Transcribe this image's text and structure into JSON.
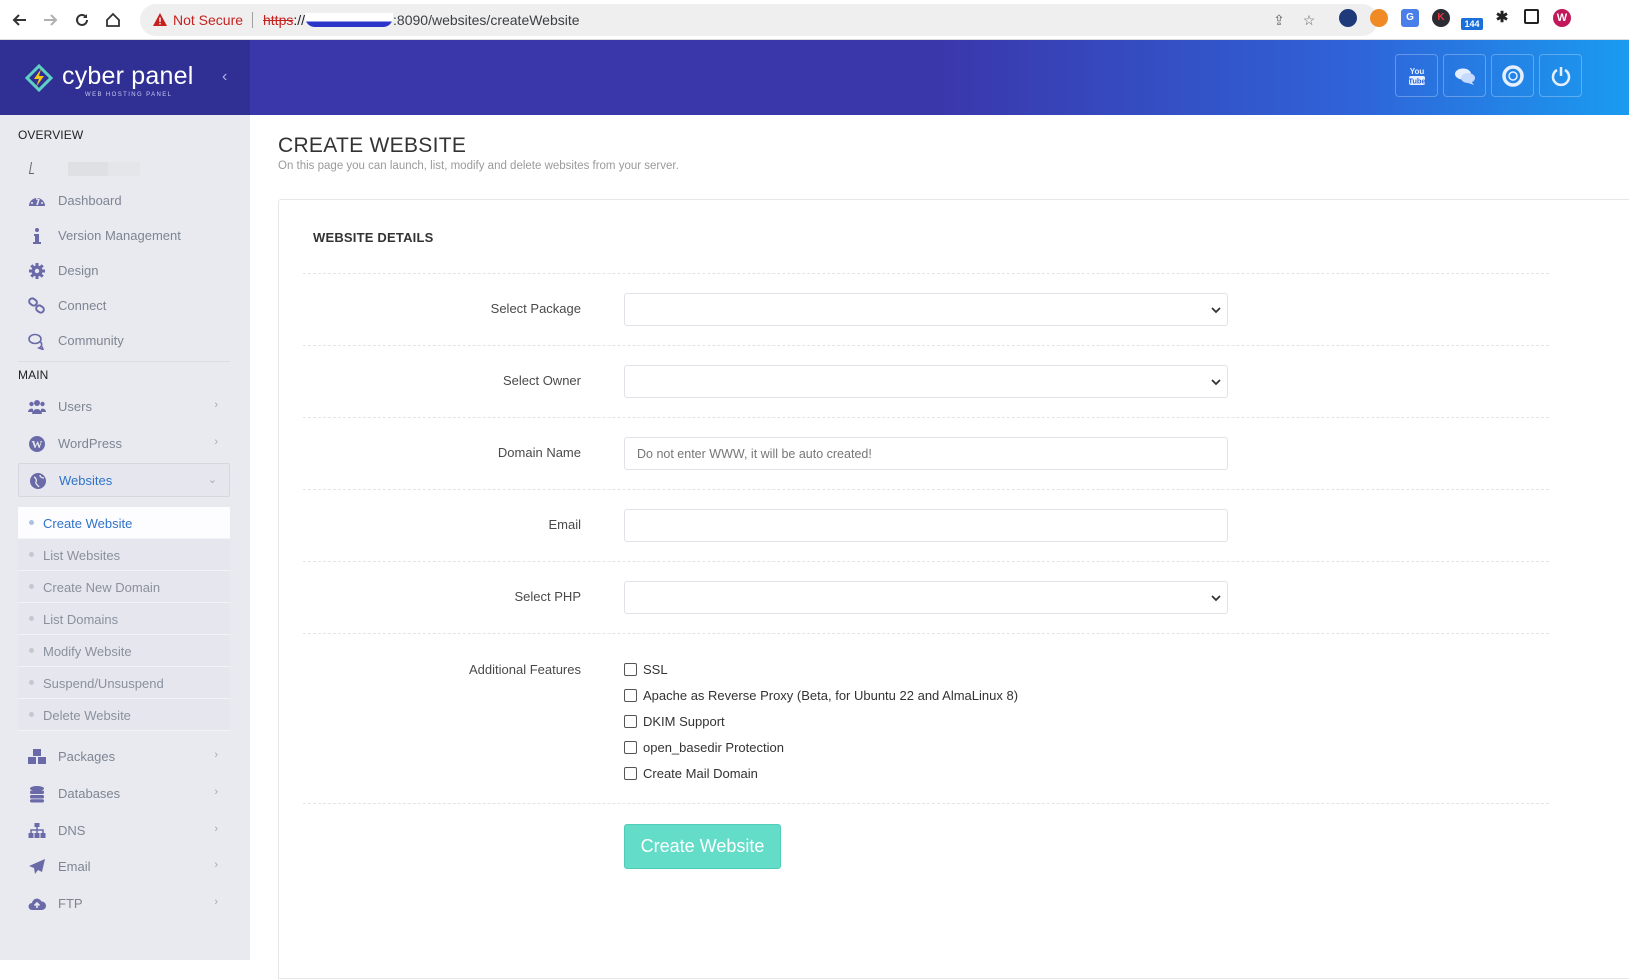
{
  "browser": {
    "security_label": "Not Secure",
    "url_scheme": "https",
    "url_rest": ":8090/websites/createWebsite",
    "extension_badge": "144",
    "profile_initial": "W"
  },
  "brand": {
    "name": "cyber panel",
    "tagline": "WEB HOSTING PANEL",
    "primary_color": "#2f2f94",
    "accent_color": "#2f73c9",
    "button_color": "#63dcc8"
  },
  "topbar": {
    "buttons": [
      {
        "icon": "youtube-icon"
      },
      {
        "icon": "chat-icon"
      },
      {
        "icon": "lifebuoy-icon"
      },
      {
        "icon": "power-icon"
      }
    ]
  },
  "sidebar": {
    "overview_label": "OVERVIEW",
    "main_label": "MAIN",
    "overview_items": [
      {
        "label": "Dashboard",
        "icon": "dashboard-icon"
      },
      {
        "label": "Version Management",
        "icon": "info-icon"
      },
      {
        "label": "Design",
        "icon": "gear-icon"
      },
      {
        "label": "Connect",
        "icon": "link-icon"
      },
      {
        "label": "Community",
        "icon": "comments-icon"
      }
    ],
    "main_items": [
      {
        "label": "Users",
        "icon": "users-icon"
      },
      {
        "label": "WordPress",
        "icon": "wordpress-icon"
      },
      {
        "label": "Websites",
        "icon": "globe-icon",
        "expanded": true
      }
    ],
    "websites_submenu": [
      {
        "label": "Create Website",
        "active": true
      },
      {
        "label": "List Websites"
      },
      {
        "label": "Create New Domain"
      },
      {
        "label": "List Domains"
      },
      {
        "label": "Modify Website"
      },
      {
        "label": "Suspend/Unsuspend"
      },
      {
        "label": "Delete Website"
      }
    ],
    "more_items": [
      {
        "label": "Packages",
        "icon": "cubes-icon"
      },
      {
        "label": "Databases",
        "icon": "database-icon"
      },
      {
        "label": "DNS",
        "icon": "sitemap-icon"
      },
      {
        "label": "Email",
        "icon": "paper-plane-icon"
      },
      {
        "label": "FTP",
        "icon": "cloud-upload-icon"
      }
    ]
  },
  "page": {
    "title": "CREATE WEBSITE",
    "subtitle": "On this page you can launch, list, modify and delete websites from your server.",
    "panel_title": "WEBSITE DETAILS",
    "fields": {
      "package": {
        "label": "Select Package",
        "value": ""
      },
      "owner": {
        "label": "Select Owner",
        "value": ""
      },
      "domain": {
        "label": "Domain Name",
        "value": "",
        "placeholder": "Do not enter WWW, it will be auto created!"
      },
      "email": {
        "label": "Email",
        "value": ""
      },
      "php": {
        "label": "Select PHP",
        "value": ""
      }
    },
    "features_label": "Additional Features",
    "features": [
      {
        "label": "SSL",
        "checked": false
      },
      {
        "label": "Apache as Reverse Proxy (Beta, for Ubuntu 22 and AlmaLinux 8)",
        "checked": false
      },
      {
        "label": "DKIM Support",
        "checked": false
      },
      {
        "label": "open_basedir Protection",
        "checked": false
      },
      {
        "label": "Create Mail Domain",
        "checked": false
      }
    ],
    "submit_label": "Create Website"
  }
}
